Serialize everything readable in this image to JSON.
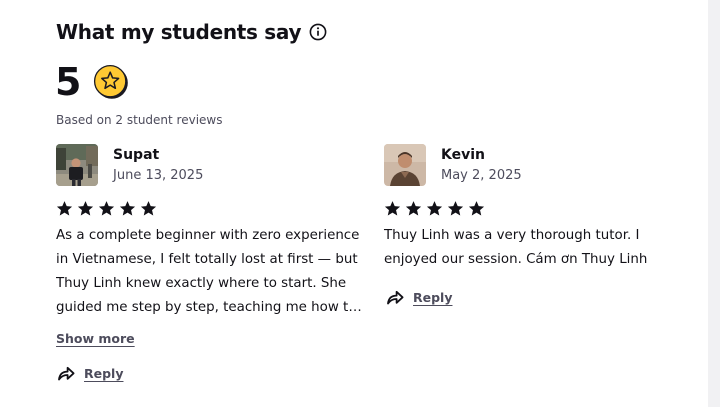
{
  "section": {
    "title": "What my students say",
    "info_icon": "info-circle-icon"
  },
  "summary": {
    "rating": "5",
    "badge_icon": "star-badge-icon",
    "based_on": "Based on 2 student reviews",
    "badge_color": "#FFC933"
  },
  "reviews": [
    {
      "name": "Supat",
      "date": "June 13, 2025",
      "stars": 5,
      "text": "As a complete beginner with zero experience in Vietnamese, I felt totally lost at first — but Thuy Linh knew exactly where to start. She guided me step by step, teaching me how to read letters,...",
      "show_more": "Show more",
      "reply": "Reply"
    },
    {
      "name": "Kevin",
      "date": "May 2, 2025",
      "stars": 5,
      "text": "Thuy Linh was a very thorough tutor. I enjoyed our session. Cám ơn Thuy Linh",
      "reply": "Reply"
    }
  ],
  "icons": {
    "star": "star-icon",
    "reply": "reply-arrow-icon"
  }
}
